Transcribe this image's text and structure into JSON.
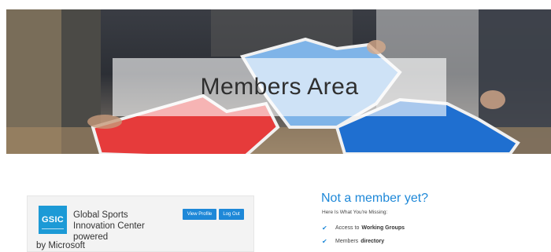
{
  "hero": {
    "title": "Members Area"
  },
  "profile_card": {
    "logo_text": "GSIC",
    "org_name": "Global Sports Innovation Center powered",
    "org_by": "by Microsoft",
    "view_profile_label": "View Profile",
    "logout_label": "Log Out"
  },
  "not_member": {
    "title": "Not a member yet?",
    "subtitle": "Here Is What You're Missing:",
    "items": [
      {
        "prefix": "Access to",
        "bold": "Working Groups"
      },
      {
        "prefix": "Members",
        "bold": "directory"
      }
    ]
  },
  "colors": {
    "accent": "#1e88d8",
    "logo_bg": "#1c9ad6",
    "puzzle_red": "#e63b3b",
    "puzzle_blue": "#1f6fd0",
    "puzzle_light_blue": "#7fb4e8"
  },
  "icons": [
    "check-icon"
  ]
}
